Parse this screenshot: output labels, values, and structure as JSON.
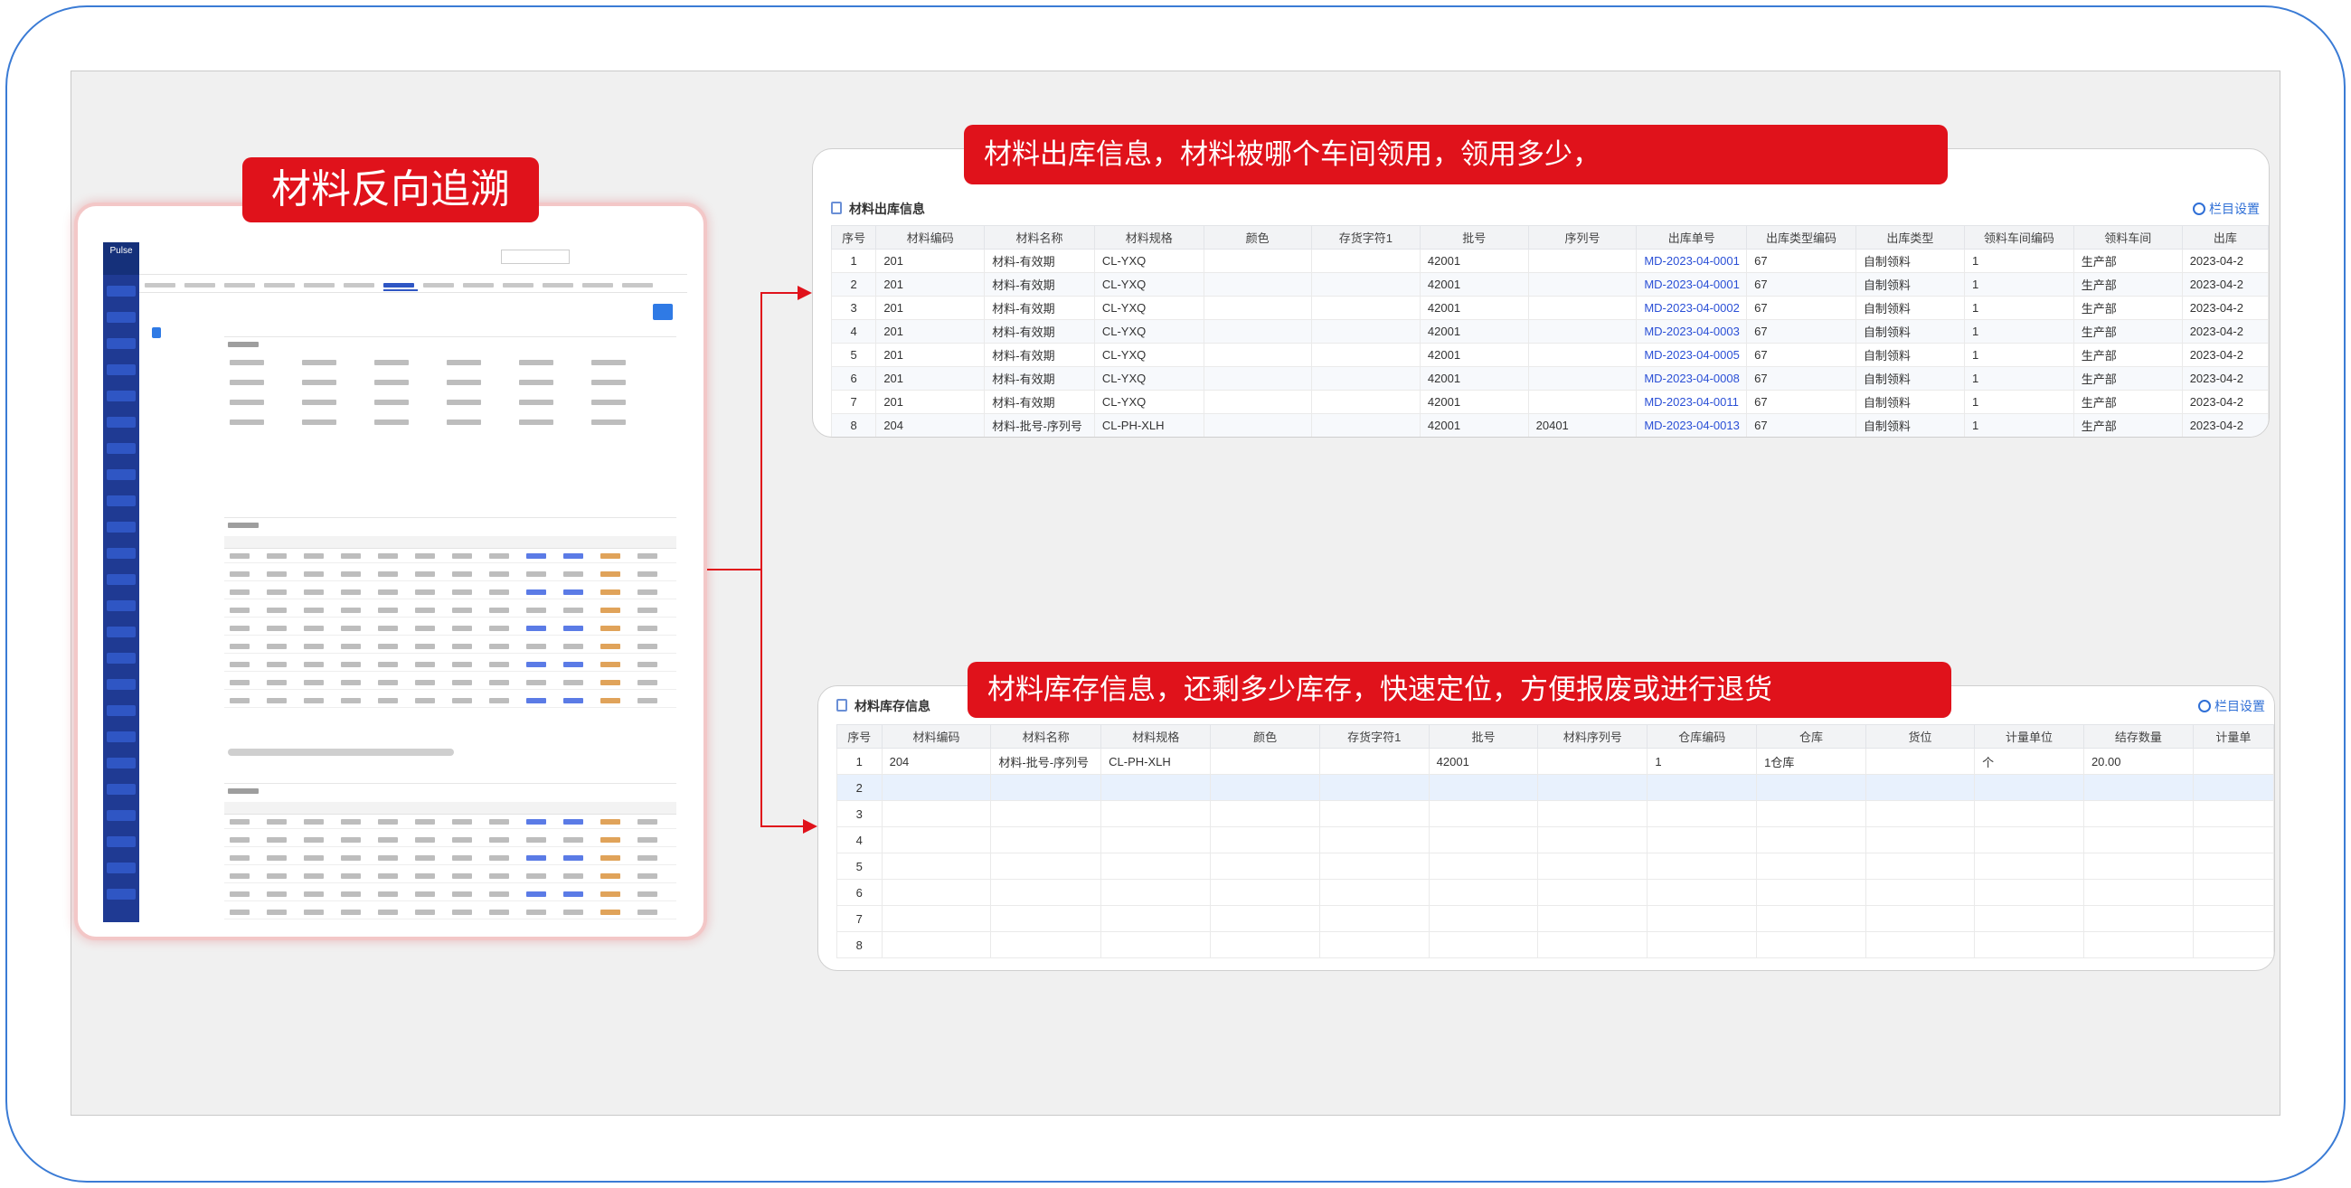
{
  "left_title": "材料反向追溯",
  "outbound_title": "材料出库信息，材料被哪个车间领用，领用多少，",
  "stock_title": "材料库存信息，还剩多少库存，快速定位，方便报废或进行退货",
  "mini_app": {
    "logo": "Pulse",
    "brand_line1": "",
    "brand_line2": "",
    "search_placeholder": "",
    "tabs": []
  },
  "outbound": {
    "header_label": "材料出库信息",
    "settings_label": "栏目设置",
    "columns": [
      "序号",
      "材料编码",
      "材料名称",
      "材料规格",
      "颜色",
      "存货字符1",
      "批号",
      "序列号",
      "出库单号",
      "出库类型编码",
      "出库类型",
      "领料车间编码",
      "领料车间",
      "出库"
    ],
    "rows": [
      [
        "1",
        "201",
        "材料-有效期",
        "CL-YXQ",
        "",
        "",
        "42001",
        "",
        "MD-2023-04-0001",
        "67",
        "自制领料",
        "1",
        "生产部",
        "2023-04-2"
      ],
      [
        "2",
        "201",
        "材料-有效期",
        "CL-YXQ",
        "",
        "",
        "42001",
        "",
        "MD-2023-04-0001",
        "67",
        "自制领料",
        "1",
        "生产部",
        "2023-04-2"
      ],
      [
        "3",
        "201",
        "材料-有效期",
        "CL-YXQ",
        "",
        "",
        "42001",
        "",
        "MD-2023-04-0002",
        "67",
        "自制领料",
        "1",
        "生产部",
        "2023-04-2"
      ],
      [
        "4",
        "201",
        "材料-有效期",
        "CL-YXQ",
        "",
        "",
        "42001",
        "",
        "MD-2023-04-0003",
        "67",
        "自制领料",
        "1",
        "生产部",
        "2023-04-2"
      ],
      [
        "5",
        "201",
        "材料-有效期",
        "CL-YXQ",
        "",
        "",
        "42001",
        "",
        "MD-2023-04-0005",
        "67",
        "自制领料",
        "1",
        "生产部",
        "2023-04-2"
      ],
      [
        "6",
        "201",
        "材料-有效期",
        "CL-YXQ",
        "",
        "",
        "42001",
        "",
        "MD-2023-04-0008",
        "67",
        "自制领料",
        "1",
        "生产部",
        "2023-04-2"
      ],
      [
        "7",
        "201",
        "材料-有效期",
        "CL-YXQ",
        "",
        "",
        "42001",
        "",
        "MD-2023-04-0011",
        "67",
        "自制领料",
        "1",
        "生产部",
        "2023-04-2"
      ],
      [
        "8",
        "204",
        "材料-批号-序列号",
        "CL-PH-XLH",
        "",
        "",
        "42001",
        "20401",
        "MD-2023-04-0013",
        "67",
        "自制领料",
        "1",
        "生产部",
        "2023-04-2"
      ]
    ]
  },
  "stock": {
    "header_label": "材料库存信息",
    "settings_label": "栏目设置",
    "columns": [
      "序号",
      "材料编码",
      "材料名称",
      "材料规格",
      "颜色",
      "存货字符1",
      "批号",
      "材料序列号",
      "仓库编码",
      "仓库",
      "货位",
      "计量单位",
      "结存数量",
      "计量单"
    ],
    "rows": [
      [
        "1",
        "204",
        "材料-批号-序列号",
        "CL-PH-XLH",
        "",
        "",
        "42001",
        "",
        "1",
        "1仓库",
        "",
        "个",
        "20.00",
        ""
      ],
      [
        "2",
        "",
        "",
        "",
        "",
        "",
        "",
        "",
        "",
        "",
        "",
        "",
        "",
        ""
      ],
      [
        "3",
        "",
        "",
        "",
        "",
        "",
        "",
        "",
        "",
        "",
        "",
        "",
        "",
        ""
      ],
      [
        "4",
        "",
        "",
        "",
        "",
        "",
        "",
        "",
        "",
        "",
        "",
        "",
        "",
        ""
      ],
      [
        "5",
        "",
        "",
        "",
        "",
        "",
        "",
        "",
        "",
        "",
        "",
        "",
        "",
        ""
      ],
      [
        "6",
        "",
        "",
        "",
        "",
        "",
        "",
        "",
        "",
        "",
        "",
        "",
        "",
        ""
      ],
      [
        "7",
        "",
        "",
        "",
        "",
        "",
        "",
        "",
        "",
        "",
        "",
        "",
        "",
        ""
      ],
      [
        "8",
        "",
        "",
        "",
        "",
        "",
        "",
        "",
        "",
        "",
        "",
        "",
        "",
        ""
      ]
    ]
  },
  "colors": {
    "accent_red": "#e0121b",
    "frame_blue": "#3a7bd5",
    "link_blue": "#2a4fd6",
    "sidebar_navy": "#1f3a93"
  }
}
